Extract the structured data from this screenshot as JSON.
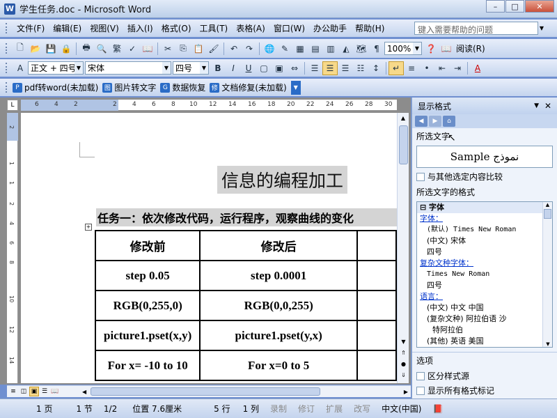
{
  "window": {
    "title": "学生任务.doc - Microsoft Word",
    "app_icon": "W",
    "min_label": "–",
    "max_label": "□",
    "close_label": "✕"
  },
  "menubar": {
    "items": [
      "文件(F)",
      "编辑(E)",
      "视图(V)",
      "插入(I)",
      "格式(O)",
      "工具(T)",
      "表格(A)",
      "窗口(W)",
      "办公助手",
      "帮助(H)"
    ],
    "help_placeholder": "键入需要帮助的问题"
  },
  "toolbar1": {
    "zoom": "100%",
    "read_label": "阅读(R)"
  },
  "toolbar2": {
    "style": "正文 + 四号",
    "font": "宋体",
    "size": "四号",
    "bold": "B",
    "italic": "I",
    "underline": "U",
    "font_color": "A"
  },
  "toolbar3": {
    "buttons": [
      "pdf转word(未加载)",
      "图片转文字",
      "数据恢复",
      "文档修复(未加载)"
    ]
  },
  "ruler": {
    "h_ticks": [
      "6",
      "4",
      "2",
      "2",
      "4",
      "6",
      "8",
      "10",
      "12",
      "14",
      "16",
      "18",
      "20",
      "22",
      "24",
      "26",
      "28",
      "30"
    ],
    "v_ticks": [
      "2",
      "1",
      "1",
      "2",
      "4",
      "6",
      "8",
      "10",
      "12",
      "14"
    ]
  },
  "document": {
    "title": "信息的编程加工",
    "task": "任务一：依次修改代码，运行程序，观察曲线的变化",
    "table": [
      [
        "修改前",
        "修改后",
        ""
      ],
      [
        "step 0.05",
        "step 0.0001",
        ""
      ],
      [
        "RGB(0,255,0)",
        "RGB(0,0,255)",
        ""
      ],
      [
        "picture1.pset(x,y)",
        "picture1.pset(y,x)",
        ""
      ],
      [
        "For x= -10    to 10",
        "For x=0    to    5",
        ""
      ]
    ]
  },
  "taskpane": {
    "title": "显示格式",
    "selected_text_label": "所选文字",
    "sample": "Sample نموذج",
    "compare_label": "与其他选定内容比较",
    "format_label": "所选文字的格式",
    "format_rows": [
      {
        "text": "⊟ 字体",
        "style": "bold"
      },
      {
        "text": "字体：",
        "style": "link"
      },
      {
        "text": "(默认) Times New Roman",
        "style": "mono"
      },
      {
        "text": "(中文) 宋体",
        "style": ""
      },
      {
        "text": "四号",
        "style": ""
      },
      {
        "text": "复杂文种字体：",
        "style": "link"
      },
      {
        "text": "Times New Roman",
        "style": "mono"
      },
      {
        "text": "四号",
        "style": ""
      },
      {
        "text": "语言：",
        "style": "link"
      },
      {
        "text": "(中文) 中文 中国",
        "style": ""
      },
      {
        "text": "(复杂文种) 阿拉伯语 沙",
        "style": ""
      },
      {
        "text": "特阿拉伯",
        "style": ""
      },
      {
        "text": "(其他) 英语 美国",
        "style": ""
      }
    ],
    "options_label": "选项",
    "option1": "区分样式源",
    "option2": "显示所有格式标记"
  },
  "statusbar": {
    "page": "1 页",
    "section": "1 节",
    "pages": "1/2",
    "position": "位置 7.6厘米",
    "line": "5 行",
    "column": "1 列",
    "rec": "录制",
    "trk": "修订",
    "ext": "扩展",
    "ovr": "改写",
    "lang": "中文(中国)"
  }
}
